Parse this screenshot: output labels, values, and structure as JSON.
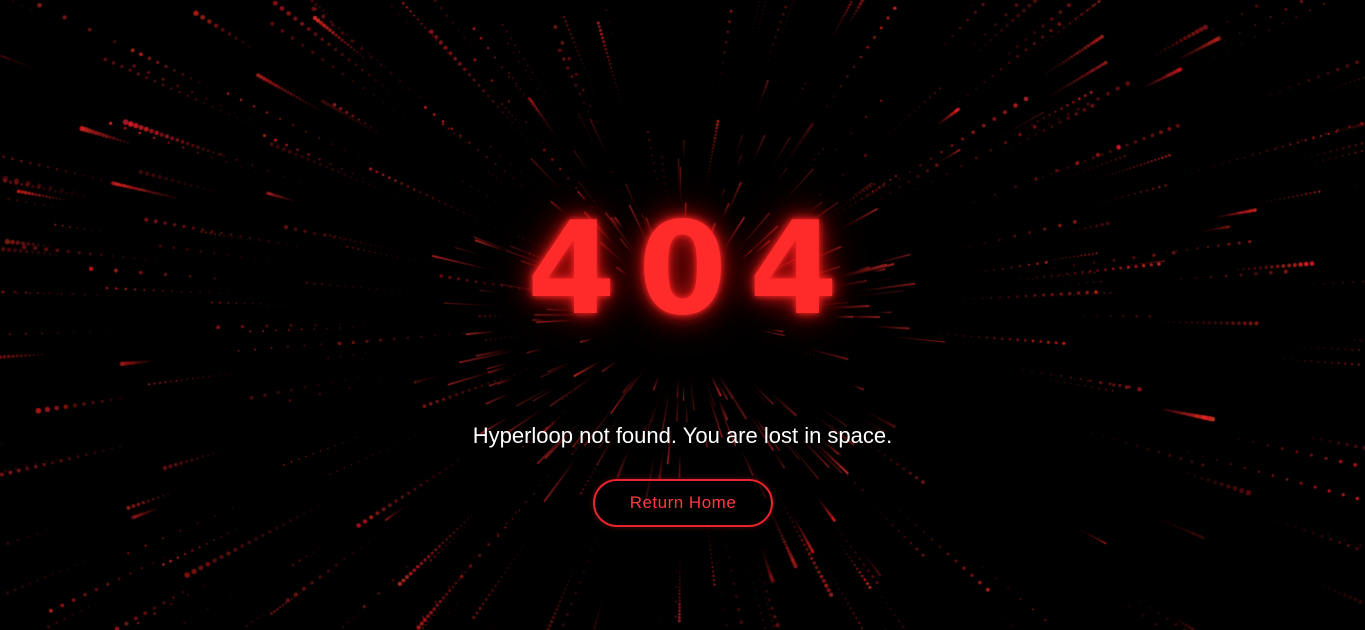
{
  "page": {
    "error_code": "404",
    "message": "Hyperloop not found. You are lost in space.",
    "home_button_label": "Return Home"
  },
  "theme": {
    "background": "#000000",
    "accent": "#ff2a2a",
    "button_border": "#e8242c",
    "text": "#ffffff"
  }
}
